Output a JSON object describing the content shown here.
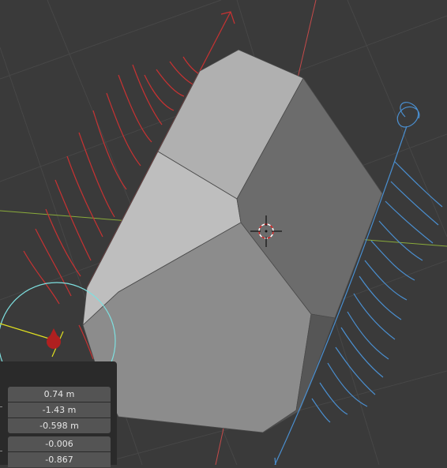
{
  "viewport": {
    "colors": {
      "background": "#3a3a3a",
      "grid": "#474747",
      "x_axis": "#c54a4a",
      "y_axis": "#8aab3a",
      "mesh_light": "#bcbcbc",
      "mesh_dark": "#6e6e6e",
      "annotation_red": "#c83232",
      "annotation_blue": "#4a8fd0",
      "light_gizmo": "#7ee0e0"
    }
  },
  "redo_panel": {
    "location": [
      "0.74 m",
      "-1.43 m",
      "-0.598 m"
    ],
    "rotation": [
      "-0.006",
      "-0.867"
    ]
  }
}
